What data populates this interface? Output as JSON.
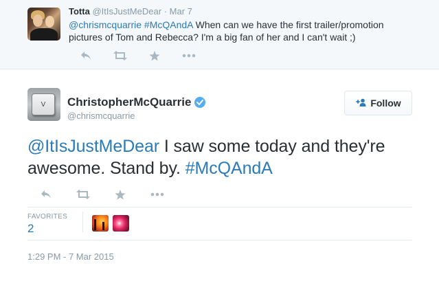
{
  "reply_tweet": {
    "name": "Totta",
    "handle": "@ItIsJustMeDear",
    "separator": "·",
    "date": "Mar 7",
    "mention": "@chrismcquarrie",
    "hashtag": "#McQAndA",
    "text_rest": " When can we have the first trailer/promotion pictures of Tom and Rebecca? I'm a big fan of her and I can't wait ;)"
  },
  "main_tweet": {
    "author_name": "ChristopherMcQuarrie",
    "author_handle": "@chrismcquarrie",
    "verified": true,
    "follow_label": "Follow",
    "avatar_key_letter": "V",
    "mention": "@ItIsJustMeDear",
    "text_middle": " I saw some today and they're awesome. Stand by. ",
    "hashtag": "#McQAndA",
    "favorites_label": "FAVORITES",
    "favorites_count": "2",
    "timestamp": "1:29 PM - 7 Mar 2015"
  },
  "actions": [
    "reply-icon",
    "retweet-icon",
    "favorite-star-icon",
    "more-dots-icon"
  ],
  "colors": {
    "link": "#2b7bb9",
    "verified": "#55acee",
    "muted": "#8899a6",
    "icon": "#aab8c2",
    "reply_bg": "#f5f8fa",
    "border": "#e1e8ed"
  }
}
